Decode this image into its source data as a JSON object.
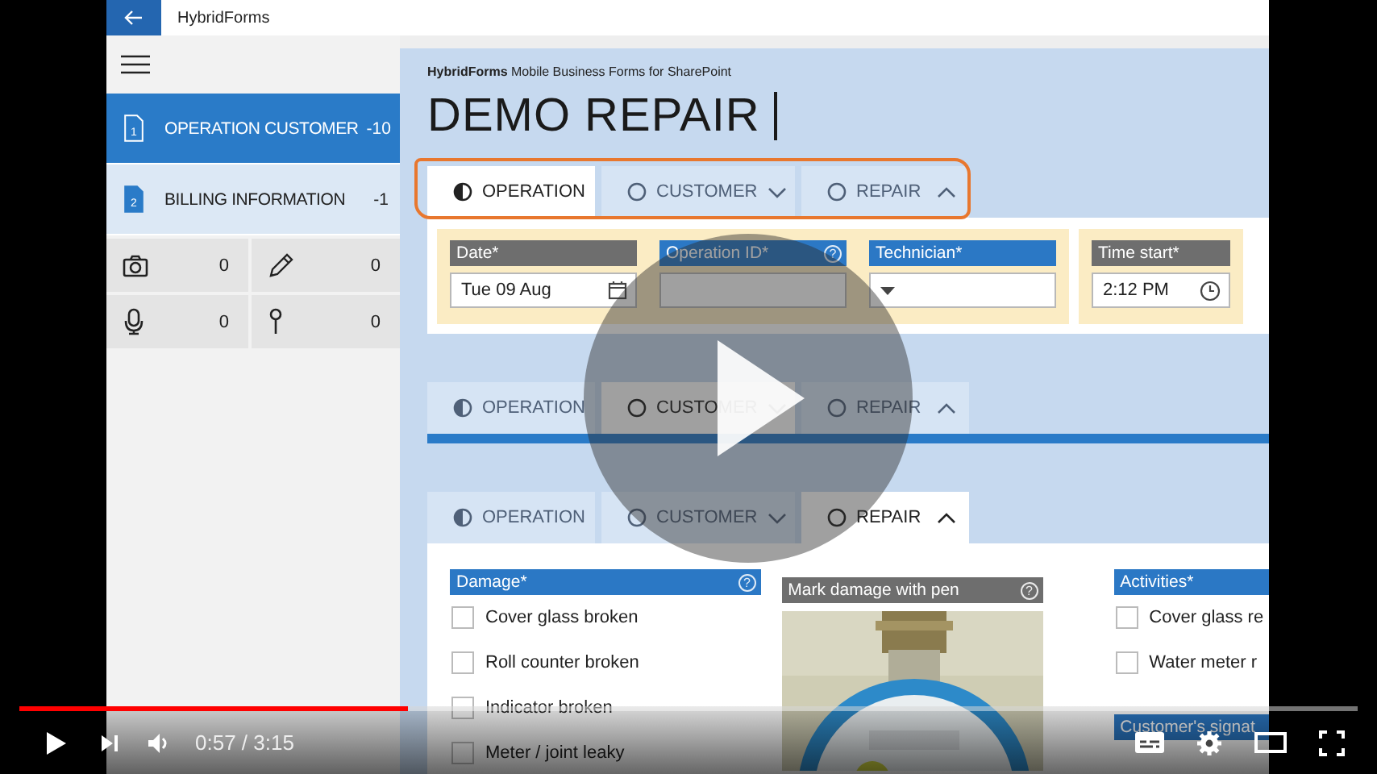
{
  "player": {
    "level": 0.29,
    "time": "0:57 / 3:15"
  },
  "app": {
    "title": "HybridForms"
  },
  "sidebar": {
    "items": [
      {
        "page": "1",
        "label": "OPERATION CUSTOMER",
        "count": "-10",
        "selected": true
      },
      {
        "page": "2",
        "label": "BILLING INFORMATION",
        "count": "-1",
        "selected": false
      }
    ],
    "counters": [
      {
        "kind": "camera",
        "count": "0"
      },
      {
        "kind": "pen",
        "count": "0"
      },
      {
        "kind": "microphone",
        "count": "0"
      },
      {
        "kind": "pin",
        "count": "0"
      }
    ]
  },
  "header": {
    "brand": "**HybridForms** Mobile Business Forms for SharePoint",
    "title": "DEMO REPAIR"
  },
  "sections": [
    {
      "highlighted": true,
      "expanded": true,
      "tabs": [
        {
          "label": "OPERATION",
          "kind": "plain",
          "started": true,
          "selected": true
        },
        {
          "label": "CUSTOMER",
          "kind": "dropdown",
          "started": false,
          "selected": false
        },
        {
          "label": "REPAIR",
          "kind": "dropup",
          "started": false,
          "selected": false
        }
      ],
      "groups": [
        {
          "kind": "fields",
          "fields": [
            {
              "kind": "date",
              "label": "Date*",
              "value": "Tue 09 Aug",
              "color": "#6e6e6e"
            },
            {
              "kind": "text",
              "label": "Operation ID*",
              "help": "?",
              "color": "#2b78c5"
            },
            {
              "kind": "dropdown",
              "label": "Technician*",
              "color": "#2b78c5"
            }
          ]
        },
        {
          "kind": "fields",
          "fields": [
            {
              "kind": "time",
              "label": "Time start*",
              "value": "2:12 PM",
              "color": "#6e6e6e"
            }
          ]
        }
      ]
    },
    {
      "expanded": false,
      "tabs": [
        {
          "label": "OPERATION",
          "kind": "plain",
          "started": true,
          "selected": false
        },
        {
          "label": "CUSTOMER",
          "kind": "dropdown",
          "started": false,
          "selected": true
        },
        {
          "label": "REPAIR",
          "kind": "dropup",
          "started": false,
          "selected": false
        }
      ]
    },
    {
      "expanded": true,
      "tabs": [
        {
          "label": "OPERATION",
          "kind": "plain",
          "started": true,
          "selected": false
        },
        {
          "label": "CUSTOMER",
          "kind": "dropdown",
          "started": false,
          "selected": false
        },
        {
          "label": "REPAIR",
          "kind": "dropup",
          "started": false,
          "selected": true
        }
      ],
      "columns": [
        {
          "groups": [
            {
              "kind": "checklist",
              "label": "Damage*",
              "help": "?",
              "color": "#2b78c5",
              "items": [
                {
                  "label": "Cover glass broken",
                  "checked": false
                },
                {
                  "label": "Roll counter broken",
                  "checked": false
                },
                {
                  "label": "Indicator broken",
                  "checked": false
                },
                {
                  "label": "Meter / joint leaky",
                  "checked": false
                }
              ]
            }
          ]
        },
        {
          "groups": [
            {
              "kind": "picture",
              "label": "Mark damage with pen",
              "help": "?",
              "color": "#6e6e6e"
            }
          ]
        },
        {
          "groups": [
            {
              "kind": "checklist",
              "label": "Activities*",
              "color": "#2b78c5",
              "items": [
                {
                  "label": "Cover glass re",
                  "checked": false
                },
                {
                  "label": "Water meter r",
                  "checked": false
                }
              ]
            },
            {
              "kind": "signature",
              "label": "Customer's signat"
            }
          ]
        }
      ]
    }
  ]
}
